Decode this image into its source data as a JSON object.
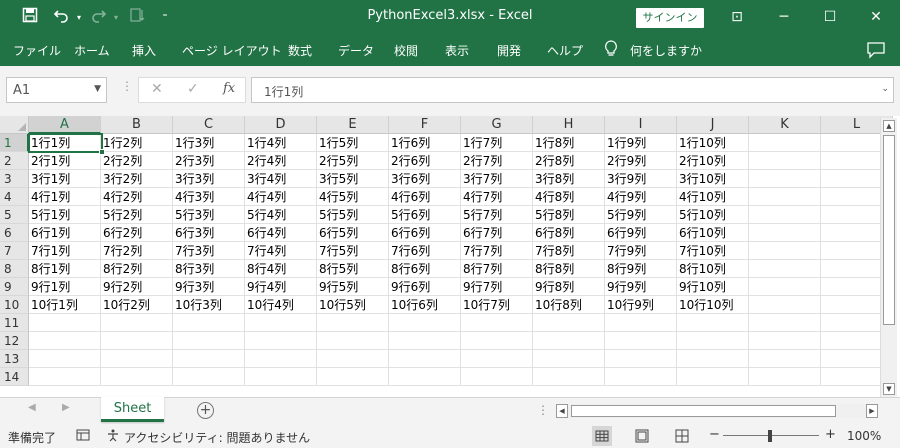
{
  "window": {
    "title": "PythonExcel3.xlsx  -  Excel",
    "signin_label": "サインイン",
    "save_icon": "save-icon",
    "undo_icon": "undo-icon",
    "redo_icon": "redo-icon",
    "minimize": "─",
    "maximize": "☐",
    "close": "✕",
    "ribbon_display": "⊡",
    "accent_color": "#217346"
  },
  "ribbon": {
    "tabs": [
      "ファイル",
      "ホーム",
      "挿入",
      "ページ レイアウト",
      "数式",
      "データ",
      "校閲",
      "表示",
      "開発",
      "ヘルプ"
    ],
    "tell_me": "何をしますか"
  },
  "formula_bar": {
    "name_box": "A1",
    "cancel": "✕",
    "enter": "✓",
    "fx": "fx",
    "content": "1行1列"
  },
  "grid": {
    "columns": [
      "A",
      "B",
      "C",
      "D",
      "E",
      "F",
      "G",
      "H",
      "I",
      "J",
      "K",
      "L"
    ],
    "rows": [
      "1",
      "2",
      "3",
      "4",
      "5",
      "6",
      "7",
      "8",
      "9",
      "10",
      "11",
      "12",
      "13",
      "14"
    ],
    "selected_cell": "A1",
    "cells": [
      [
        "1行1列",
        "1行2列",
        "1行3列",
        "1行4列",
        "1行5列",
        "1行6列",
        "1行7列",
        "1行8列",
        "1行9列",
        "1行10列"
      ],
      [
        "2行1列",
        "2行2列",
        "2行3列",
        "2行4列",
        "2行5列",
        "2行6列",
        "2行7列",
        "2行8列",
        "2行9列",
        "2行10列"
      ],
      [
        "3行1列",
        "3行2列",
        "3行3列",
        "3行4列",
        "3行5列",
        "3行6列",
        "3行7列",
        "3行8列",
        "3行9列",
        "3行10列"
      ],
      [
        "4行1列",
        "4行2列",
        "4行3列",
        "4行4列",
        "4行5列",
        "4行6列",
        "4行7列",
        "4行8列",
        "4行9列",
        "4行10列"
      ],
      [
        "5行1列",
        "5行2列",
        "5行3列",
        "5行4列",
        "5行5列",
        "5行6列",
        "5行7列",
        "5行8列",
        "5行9列",
        "5行10列"
      ],
      [
        "6行1列",
        "6行2列",
        "6行3列",
        "6行4列",
        "6行5列",
        "6行6列",
        "6行7列",
        "6行8列",
        "6行9列",
        "6行10列"
      ],
      [
        "7行1列",
        "7行2列",
        "7行3列",
        "7行4列",
        "7行5列",
        "7行6列",
        "7行7列",
        "7行8列",
        "7行9列",
        "7行10列"
      ],
      [
        "8行1列",
        "8行2列",
        "8行3列",
        "8行4列",
        "8行5列",
        "8行6列",
        "8行7列",
        "8行8列",
        "8行9列",
        "8行10列"
      ],
      [
        "9行1列",
        "9行2列",
        "9行3列",
        "9行4列",
        "9行5列",
        "9行6列",
        "9行7列",
        "9行8列",
        "9行9列",
        "9行10列"
      ],
      [
        "10行1列",
        "10行2列",
        "10行3列",
        "10行4列",
        "10行5列",
        "10行6列",
        "10行7列",
        "10行8列",
        "10行9列",
        "10行10列"
      ]
    ]
  },
  "sheets": {
    "tabs": [
      "Sheet"
    ],
    "add": "+"
  },
  "status_bar": {
    "ready": "準備完了",
    "accessibility": "アクセシビリティ: 問題ありません",
    "zoom_minus": "−",
    "zoom_plus": "+",
    "zoom": "100%"
  }
}
